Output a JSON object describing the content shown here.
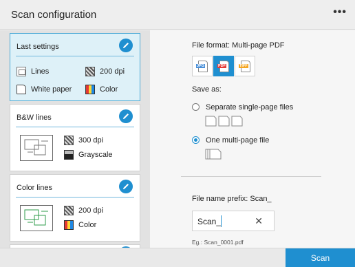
{
  "header": {
    "title": "Scan configuration",
    "more_label": "•••"
  },
  "presets": [
    {
      "title": "Last settings",
      "selected": true,
      "specs": [
        {
          "icon": "lines-icon",
          "label": "Lines"
        },
        {
          "icon": "dpi-icon",
          "label": "200 dpi"
        },
        {
          "icon": "white-paper-icon",
          "label": "White paper"
        },
        {
          "icon": "color-icon",
          "label": "Color"
        }
      ]
    },
    {
      "title": "B&W lines",
      "selected": false,
      "specs": [
        {
          "icon": "dpi-icon",
          "label": "300 dpi"
        },
        {
          "icon": "grayscale-icon",
          "label": "Grayscale"
        }
      ]
    },
    {
      "title": "Color lines",
      "selected": false,
      "specs": [
        {
          "icon": "dpi-icon",
          "label": "200 dpi"
        },
        {
          "icon": "color-icon",
          "label": "Color"
        }
      ]
    }
  ],
  "settings": {
    "file_format_label": "File format: Multi-page PDF",
    "formats": [
      {
        "label": "JPG",
        "active": false,
        "tag_color": "#4a90d9"
      },
      {
        "label": "PDF",
        "active": true,
        "tag_color": "#e53935"
      },
      {
        "label": "TIFF",
        "active": false,
        "tag_color": "#f5a623"
      }
    ],
    "save_as_label": "Save as:",
    "options": [
      {
        "label": "Separate single-page files",
        "checked": false
      },
      {
        "label": "One multi-page file",
        "checked": true
      }
    ],
    "prefix_label": "File name prefix: Scan_",
    "prefix_value": "Scan_",
    "clear_label": "✕",
    "example": "Eg.: Scan_0001.pdf"
  },
  "footer": {
    "scan_label": "Scan"
  },
  "colors": {
    "accent": "#1f8fd0",
    "selected_card_bg": "#def1f8"
  }
}
